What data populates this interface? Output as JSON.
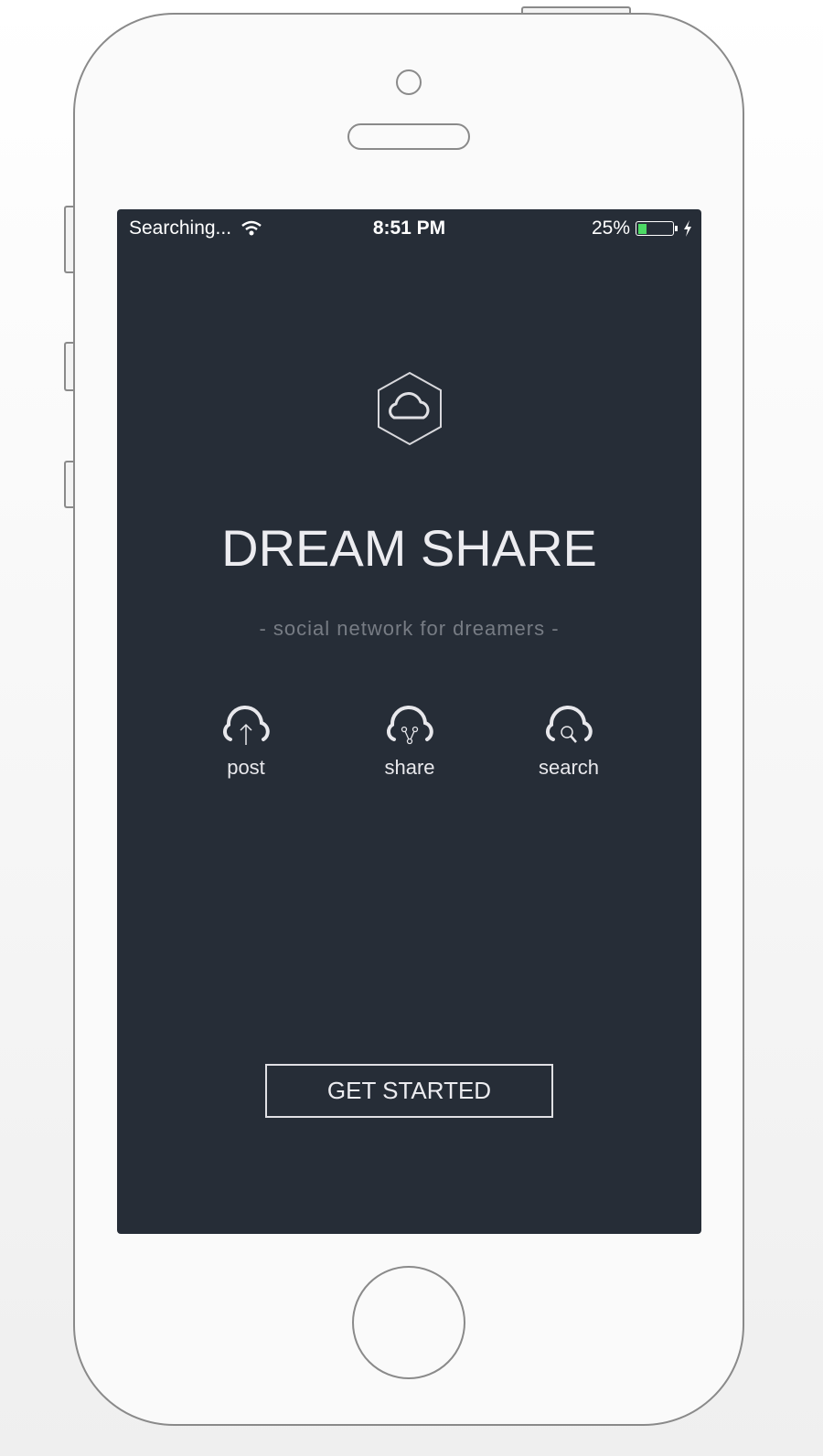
{
  "status_bar": {
    "carrier": "Searching...",
    "time": "8:51 PM",
    "battery_text": "25%",
    "battery_level": 0.25,
    "battery_color": "#4cd964"
  },
  "app": {
    "title": "DREAM SHARE",
    "tagline": "- social network for dreamers -",
    "features": [
      {
        "label": "post",
        "icon": "cloud-upload-icon"
      },
      {
        "label": "share",
        "icon": "cloud-share-icon"
      },
      {
        "label": "search",
        "icon": "cloud-search-icon"
      }
    ],
    "cta_label": "GET STARTED",
    "background_color": "#262d37"
  }
}
